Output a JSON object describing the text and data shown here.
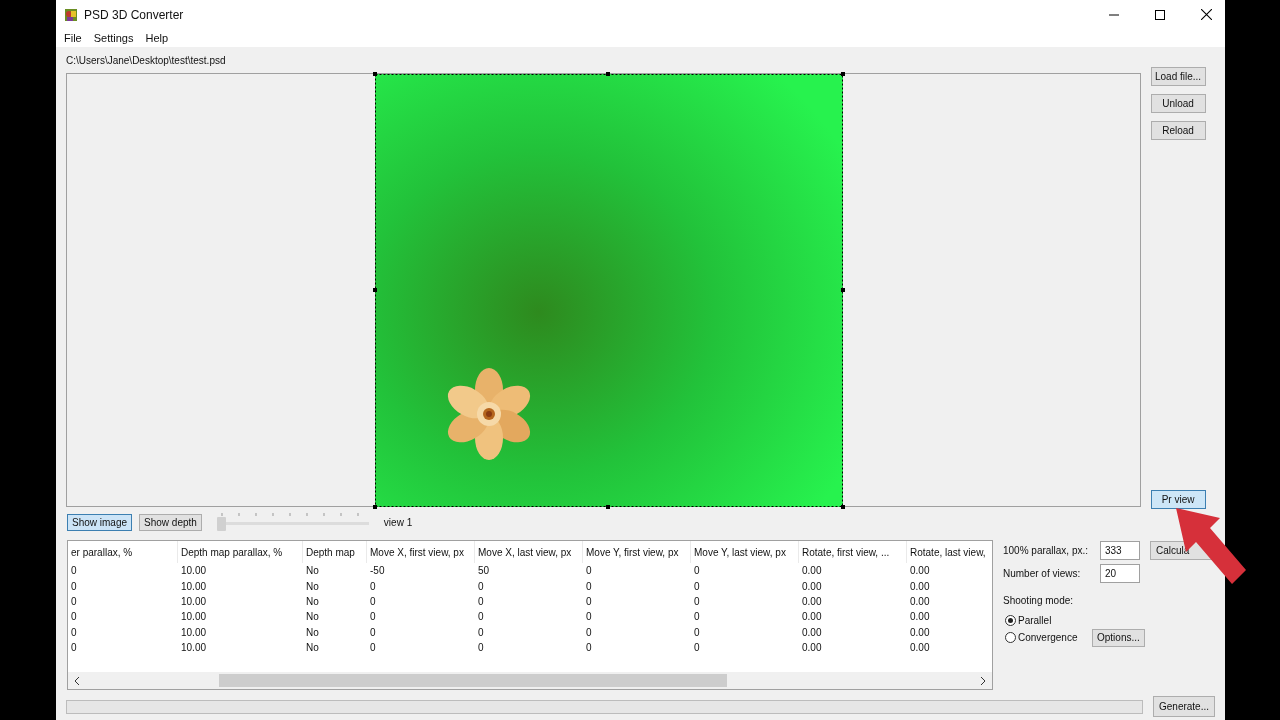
{
  "window": {
    "title": "PSD 3D Converter"
  },
  "menu": [
    "File",
    "Settings",
    "Help"
  ],
  "file_path": "C:\\Users\\Jane\\Desktop\\test\\test.psd",
  "side_buttons": [
    "Load file...",
    "Unload",
    "Reload"
  ],
  "preview_button": "Pr view",
  "view_toggles": [
    {
      "label": "Show image",
      "selected": true
    },
    {
      "label": "Show depth",
      "selected": false
    }
  ],
  "view_slider": {
    "level": 0,
    "reading": "view 1"
  },
  "table": {
    "columns": [
      "er parallax, %",
      "Depth map parallax, %",
      "Depth map",
      "Move X, first view, px",
      "Move X, last view, px",
      "Move Y, first view, px",
      "Move Y, last view, px",
      "Rotate, first view, ...",
      "Rotate, last view,"
    ],
    "rows": [
      [
        "0",
        "10.00",
        "No",
        "-50",
        "50",
        "0",
        "0",
        "0.00",
        "0.00"
      ],
      [
        "0",
        "10.00",
        "No",
        "0",
        "0",
        "0",
        "0",
        "0.00",
        "0.00"
      ],
      [
        "0",
        "10.00",
        "No",
        "0",
        "0",
        "0",
        "0",
        "0.00",
        "0.00"
      ],
      [
        "0",
        "10.00",
        "No",
        "0",
        "0",
        "0",
        "0",
        "0.00",
        "0.00"
      ],
      [
        "0",
        "10.00",
        "No",
        "0",
        "0",
        "0",
        "0",
        "0.00",
        "0.00"
      ],
      [
        "0",
        "10.00",
        "No",
        "0",
        "0",
        "0",
        "0",
        "0.00",
        "0.00"
      ]
    ]
  },
  "params": {
    "parallax_label": "100% parallax, px.:",
    "parallax_value": "333",
    "calculate_button": "Calcula",
    "views_label": "Number of views:",
    "views_value": "20"
  },
  "shooting_mode": {
    "label": "Shooting mode:",
    "options": [
      {
        "label": "Parallel",
        "selected": true
      },
      {
        "label": "Convergence",
        "selected": false
      }
    ],
    "options_button": "Options..."
  },
  "generate_button": "Generate..."
}
